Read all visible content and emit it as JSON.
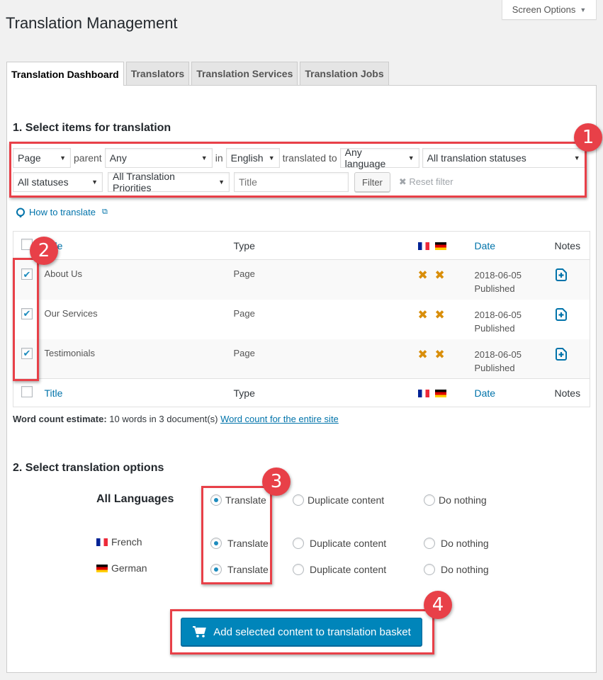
{
  "screen_options": {
    "label": "Screen Options",
    "icon": "caret-down-icon"
  },
  "page_title": "Translation Management",
  "tabs": [
    {
      "label": "Translation Dashboard",
      "active": true
    },
    {
      "label": "Translators",
      "active": false
    },
    {
      "label": "Translation Services",
      "active": false
    },
    {
      "label": "Translation Jobs",
      "active": false
    }
  ],
  "section1": {
    "heading": "1. Select items for translation",
    "filters": {
      "type_select": "Page",
      "parent_label": "parent",
      "parent_select": "Any",
      "in_label": "in",
      "language_select": "English",
      "translated_to_label": "translated to",
      "target_language_select": "Any language",
      "translation_status_select": "All translation statuses",
      "status_select": "All statuses",
      "priority_select": "All Translation Priorities",
      "title_placeholder": "Title",
      "title_value": "",
      "filter_button": "Filter",
      "reset_filter": "Reset filter"
    },
    "how_to_translate": "How to translate",
    "table": {
      "headers": {
        "title": "Title",
        "type": "Type",
        "date": "Date",
        "notes": "Notes"
      },
      "languages": [
        "French",
        "German"
      ],
      "rows": [
        {
          "title": "About Us",
          "type": "Page",
          "checked": true,
          "fr_status": "not-translated",
          "de_status": "not-translated",
          "date": "2018-06-05",
          "status": "Published"
        },
        {
          "title": "Our Services",
          "type": "Page",
          "checked": true,
          "fr_status": "not-translated",
          "de_status": "not-translated",
          "date": "2018-06-05",
          "status": "Published"
        },
        {
          "title": "Testimonials",
          "type": "Page",
          "checked": true,
          "fr_status": "not-translated",
          "de_status": "not-translated",
          "date": "2018-06-05",
          "status": "Published"
        }
      ]
    },
    "word_count": {
      "label": "Word count estimate:",
      "text": "10 words in 3 document(s)",
      "link": "Word count for the entire site"
    }
  },
  "section2": {
    "heading": "2. Select translation options",
    "options": [
      "Translate",
      "Duplicate content",
      "Do nothing"
    ],
    "all_languages": {
      "label": "All Languages",
      "selected": "Translate"
    },
    "languages": [
      {
        "name": "French",
        "selected": "Translate"
      },
      {
        "name": "German",
        "selected": "Translate"
      }
    ]
  },
  "submit_button": "Add selected content to translation basket",
  "annotations": [
    "1",
    "2",
    "3",
    "4"
  ],
  "colors": {
    "accent": "#0073aa",
    "primary_button": "#0085ba",
    "annotation": "#e84048",
    "not_translated": "#d98e0a"
  }
}
